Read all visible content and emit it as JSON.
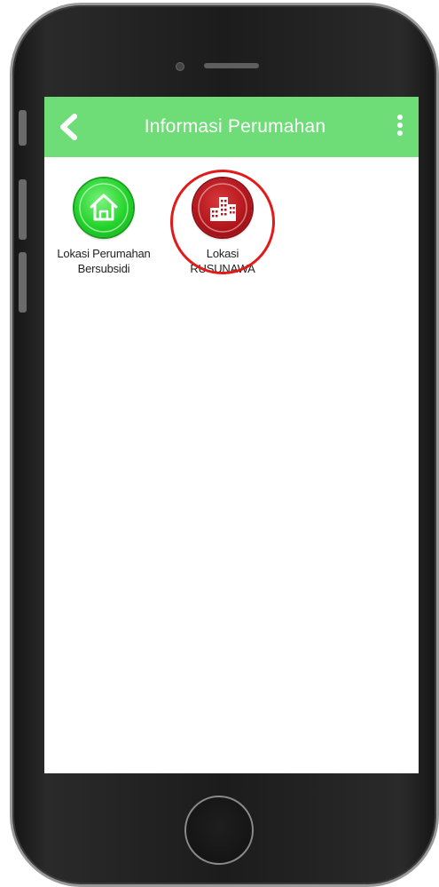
{
  "appbar": {
    "title": "Informasi Perumahan",
    "back_icon": "chevron-left-icon",
    "more_icon": "more-vertical-icon",
    "color": "#6edc77"
  },
  "menu": [
    {
      "label": "Lokasi Perumahan\nBersubsidi",
      "icon": "house-icon",
      "color": "#22d32a"
    },
    {
      "label": "Lokasi\nRUSUNAWA",
      "icon": "buildings-icon",
      "color": "#b3161c"
    }
  ],
  "annotation": {
    "highlight_color": "#e11a1a",
    "highlighted_item": "Lokasi RUSUNAWA"
  }
}
